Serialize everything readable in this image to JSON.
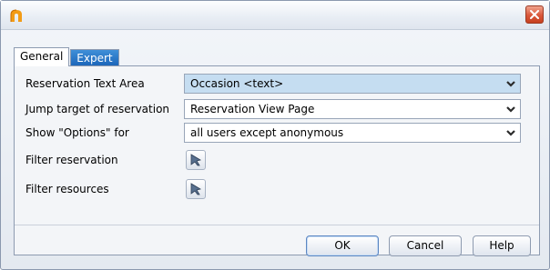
{
  "titlebar": {
    "app_icon": "app-logo-icon",
    "close_icon": "close-icon",
    "close_color": "#d9573a"
  },
  "tabs": [
    {
      "label": "General",
      "active": true
    },
    {
      "label": "Expert",
      "active": false
    }
  ],
  "form": {
    "reservation_text_area": {
      "label": "Reservation Text Area",
      "value": "Occasion <text>"
    },
    "jump_target": {
      "label": "Jump target of reservation",
      "value": "Reservation View Page"
    },
    "show_options": {
      "label": "Show \"Options\" for",
      "value": "all users except anonymous"
    },
    "filter_reservation": {
      "label": "Filter reservation",
      "icon": "filter-edit-icon"
    },
    "filter_resources": {
      "label": "Filter resources",
      "icon": "filter-edit-icon"
    }
  },
  "buttons": {
    "ok": "OK",
    "cancel": "Cancel",
    "help": "Help"
  },
  "colors": {
    "accent_tab": "#1b64b8",
    "highlight_select": "#c5ddf1"
  }
}
